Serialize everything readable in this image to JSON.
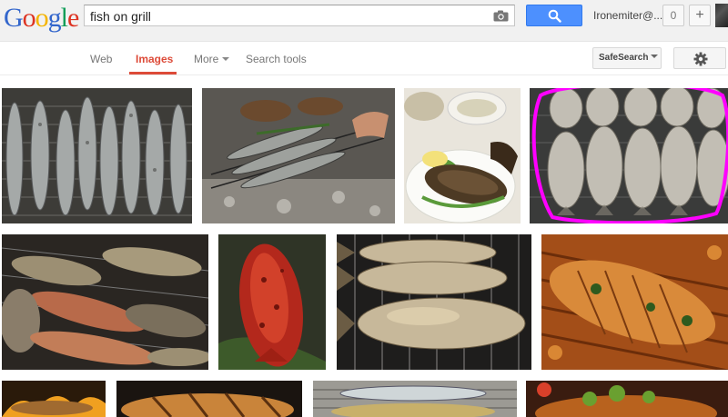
{
  "header": {
    "logo_letters": [
      "G",
      "o",
      "o",
      "g",
      "l",
      "e"
    ],
    "search": {
      "query": "fish on grill",
      "placeholder": ""
    },
    "camera_icon": "camera-icon",
    "search_icon": "search-icon",
    "username": "Ironemiter@...",
    "notification_count": "0",
    "share_label": "+"
  },
  "nav": {
    "tabs": [
      {
        "label": "Web",
        "active": false
      },
      {
        "label": "Images",
        "active": true
      },
      {
        "label": "More",
        "active": false
      },
      {
        "label": "Search tools",
        "active": false
      }
    ],
    "safesearch_label": "SafeSearch",
    "settings_icon": "gear-icon"
  },
  "results": {
    "rows": [
      {
        "row": 1,
        "images": [
          "sardines-on-grill",
          "fish-grilling-over-coals",
          "plated-grilled-fish",
          "grilled-fish-circled"
        ]
      },
      {
        "row": 2,
        "images": [
          "mixed-fish-on-grill",
          "spiced-red-fish",
          "fish-on-wire-rack",
          "grilled-fish-in-basket"
        ]
      },
      {
        "row": 3,
        "images": [
          "fish-over-flames",
          "grill-marked-fish",
          "fish-on-grate",
          "herbed-fish"
        ]
      }
    ],
    "annotation_color": "#ff00ff"
  },
  "colors": {
    "accent": "#dd4b39",
    "search_button": "#4d90fe",
    "topbar": "#f1f1f1"
  }
}
